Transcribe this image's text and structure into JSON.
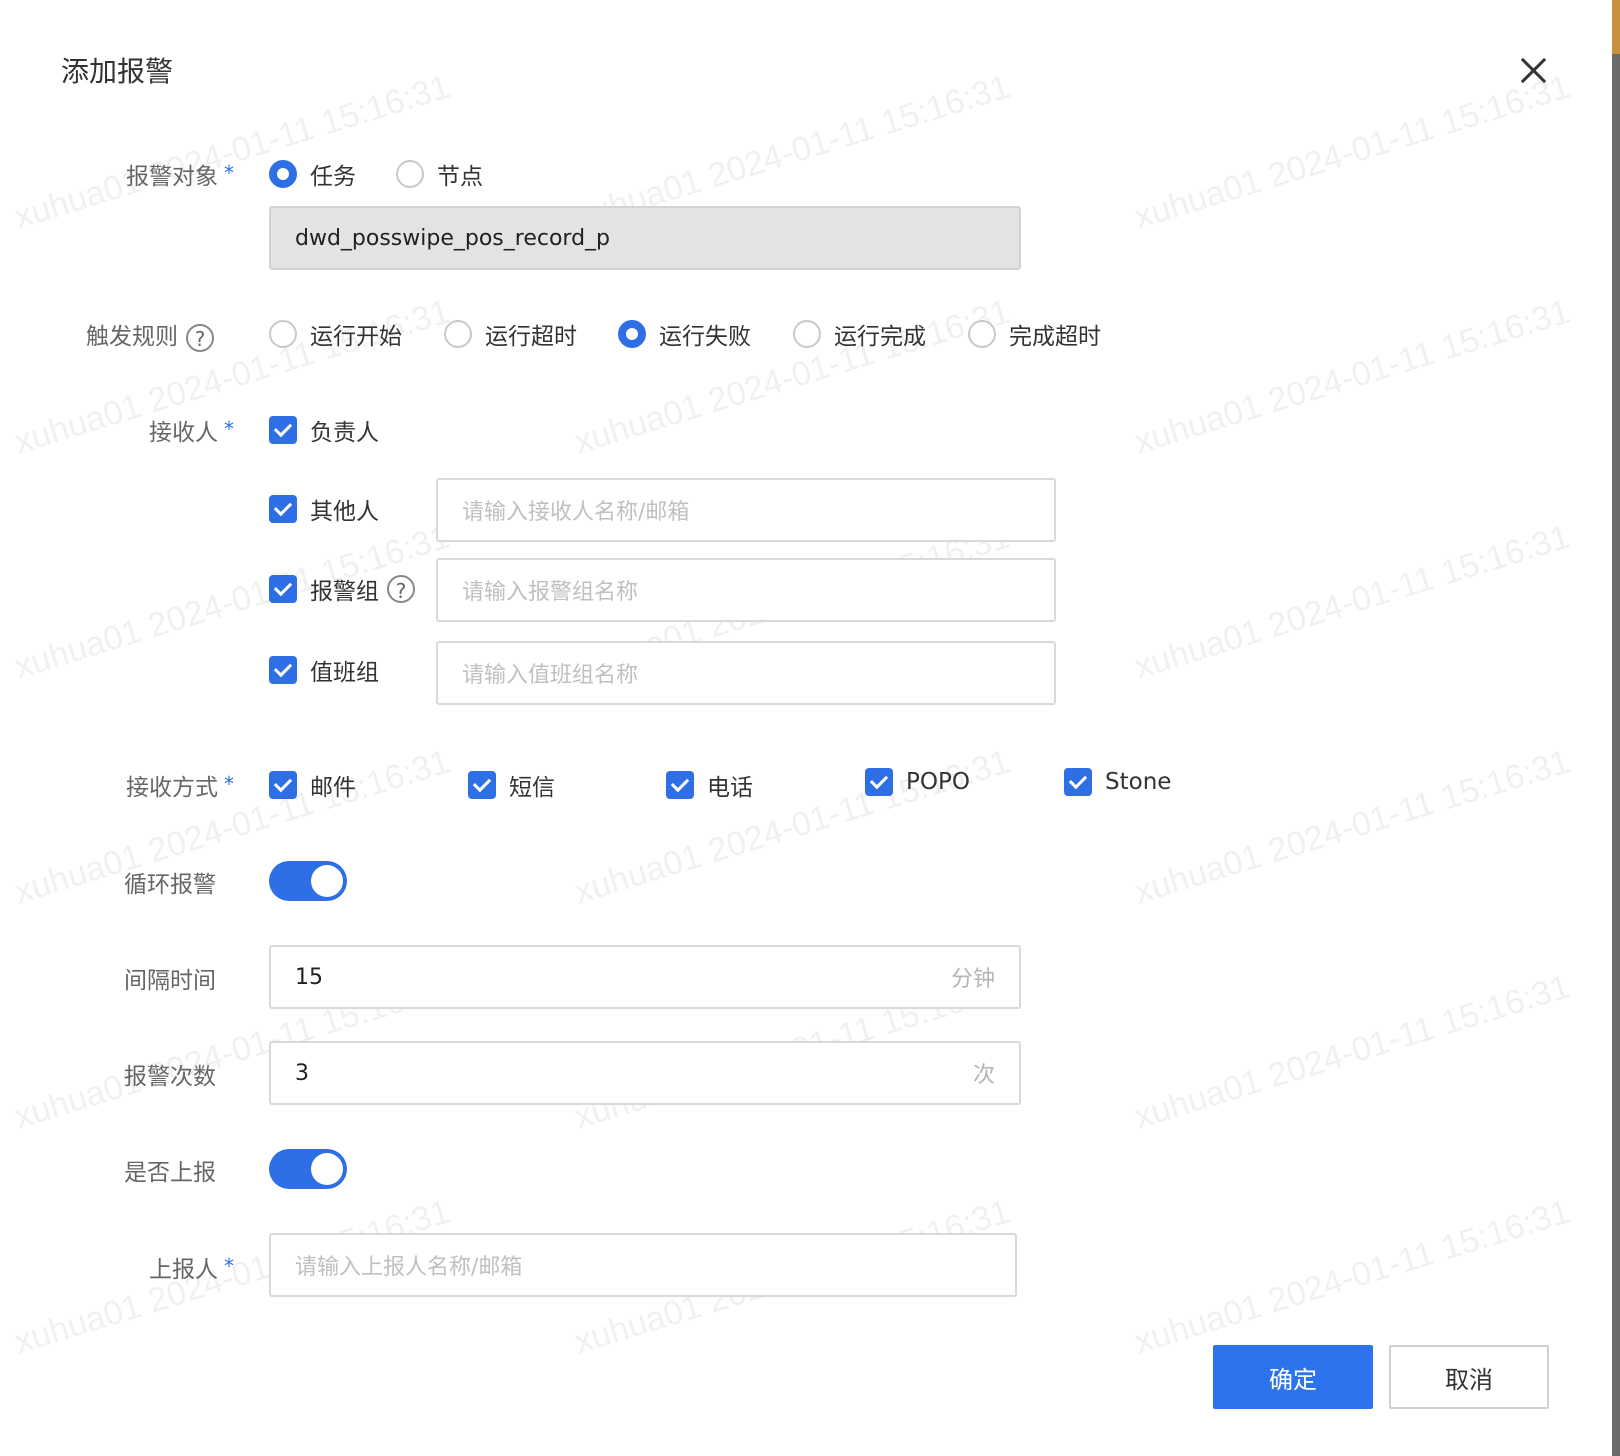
{
  "dialog": {
    "title": "添加报警",
    "close_icon": "close-icon"
  },
  "alert_target": {
    "label": "报警对象",
    "required_mark": "*",
    "options": [
      {
        "label": "任务",
        "selected": true
      },
      {
        "label": "节点",
        "selected": false
      }
    ],
    "value": "dwd_posswipe_pos_record_p"
  },
  "trigger_rule": {
    "label": "触发规则",
    "help_icon": "?",
    "options": [
      {
        "label": "运行开始",
        "selected": false
      },
      {
        "label": "运行超时",
        "selected": false
      },
      {
        "label": "运行失败",
        "selected": true
      },
      {
        "label": "运行完成",
        "selected": false
      },
      {
        "label": "完成超时",
        "selected": false
      }
    ]
  },
  "receivers": {
    "label": "接收人",
    "required_mark": "*",
    "owner": {
      "label": "负责人",
      "checked": true
    },
    "others": {
      "label": "其他人",
      "checked": true,
      "placeholder": "请输入接收人名称/邮箱"
    },
    "alert_group": {
      "label": "报警组",
      "help_icon": "?",
      "checked": true,
      "placeholder": "请输入报警组名称"
    },
    "duty_group": {
      "label": "值班组",
      "checked": true,
      "placeholder": "请输入值班组名称"
    }
  },
  "receive_method": {
    "label": "接收方式",
    "required_mark": "*",
    "options": [
      {
        "label": "邮件",
        "checked": true
      },
      {
        "label": "短信",
        "checked": true
      },
      {
        "label": "电话",
        "checked": true
      },
      {
        "label": "POPO",
        "checked": true
      },
      {
        "label": "Stone",
        "checked": true
      }
    ]
  },
  "loop_alert": {
    "label": "循环报警",
    "on": true
  },
  "interval": {
    "label": "间隔时间",
    "value": "15",
    "suffix": "分钟"
  },
  "alert_count": {
    "label": "报警次数",
    "value": "3",
    "suffix": "次"
  },
  "escalate": {
    "label": "是否上报",
    "on": true
  },
  "reporter": {
    "label": "上报人",
    "required_mark": "*",
    "placeholder": "请输入上报人名称/邮箱"
  },
  "footer": {
    "confirm": "确定",
    "cancel": "取消"
  },
  "watermark": {
    "text": "xuhua01 2024-01-11 15:16:31"
  },
  "colors": {
    "accent": "#2e6fe6",
    "primary_button": "#2e73ee"
  }
}
